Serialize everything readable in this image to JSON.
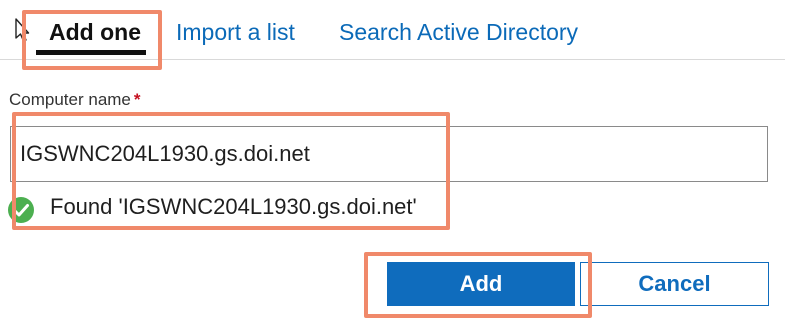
{
  "tabs": {
    "active_label": "Add one",
    "import_label": "Import a list",
    "search_label": "Search Active Directory"
  },
  "form": {
    "computer_name_label": "Computer name",
    "required_marker": "*",
    "computer_name_value": "IGSWNC204L1930.gs.doi.net",
    "validation_message": "Found 'IGSWNC204L1930.gs.doi.net'"
  },
  "buttons": {
    "add_label": "Add",
    "cancel_label": "Cancel"
  },
  "icons": {
    "pointer": "mouse-pointer-icon",
    "success": "checkmark-circle-icon"
  },
  "colors": {
    "accent": "#0f6cbd",
    "link": "#0b6ab8",
    "success": "#4caf50",
    "required": "#c50f1f",
    "highlight": "#f0896a"
  }
}
